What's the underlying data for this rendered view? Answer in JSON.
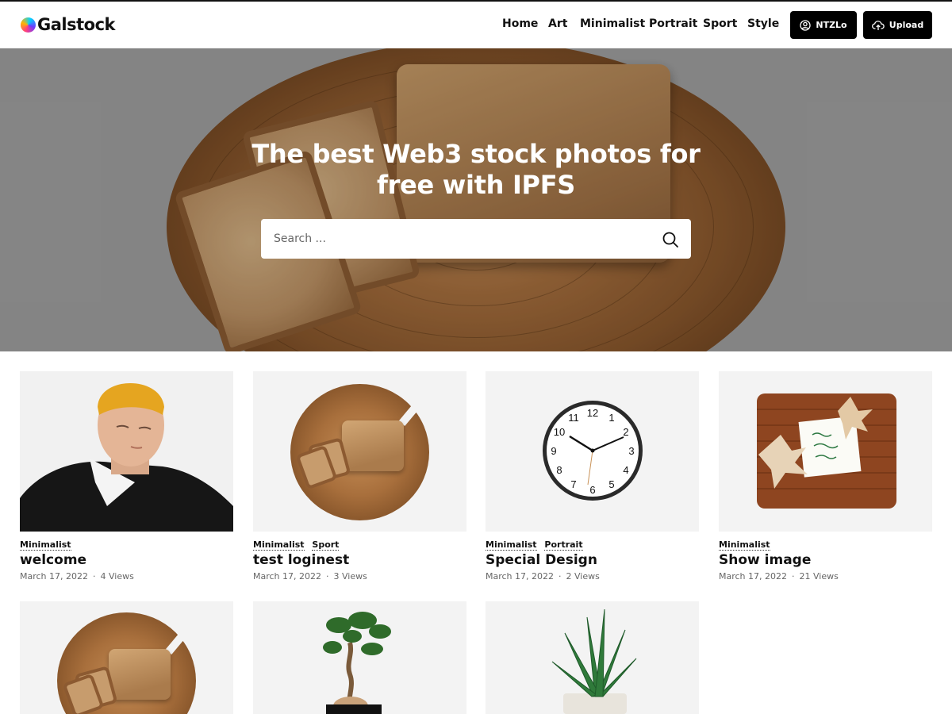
{
  "brand": {
    "name": "Galstock"
  },
  "nav": {
    "items": [
      {
        "label": "Home"
      },
      {
        "label": "Art"
      },
      {
        "label": "Minimalist"
      },
      {
        "label": "Portrait"
      },
      {
        "label": "Sport"
      },
      {
        "label": "Style"
      }
    ],
    "account_label": "NTZLo",
    "upload_label": "Upload"
  },
  "hero": {
    "title_line1": "The best Web3 stock photos for",
    "title_line2": "free with IPFS",
    "search_placeholder": "Search ..."
  },
  "cards": [
    {
      "tags": [
        "Minimalist"
      ],
      "title": "welcome",
      "date": "March 17, 2022",
      "views": "4 Views"
    },
    {
      "tags": [
        "Minimalist",
        "Sport"
      ],
      "title": "test loginest",
      "date": "March 17, 2022",
      "views": "3 Views"
    },
    {
      "tags": [
        "Minimalist",
        "Portrait"
      ],
      "title": "Special Design",
      "date": "March 17, 2022",
      "views": "2 Views"
    },
    {
      "tags": [
        "Minimalist"
      ],
      "title": "Show image",
      "date": "March 17, 2022",
      "views": "21 Views"
    }
  ],
  "meta_separator": "·",
  "clock_numbers": [
    "12",
    "1",
    "2",
    "3",
    "4",
    "5",
    "6",
    "7",
    "8",
    "9",
    "10",
    "11"
  ],
  "colors": {
    "button_bg": "#000000",
    "hero_bg": "#a2a2a2",
    "card_bg": "#f3f3f3"
  },
  "icons": {
    "account": "user-circle-icon",
    "upload": "cloud-upload-icon",
    "search": "search-icon"
  }
}
